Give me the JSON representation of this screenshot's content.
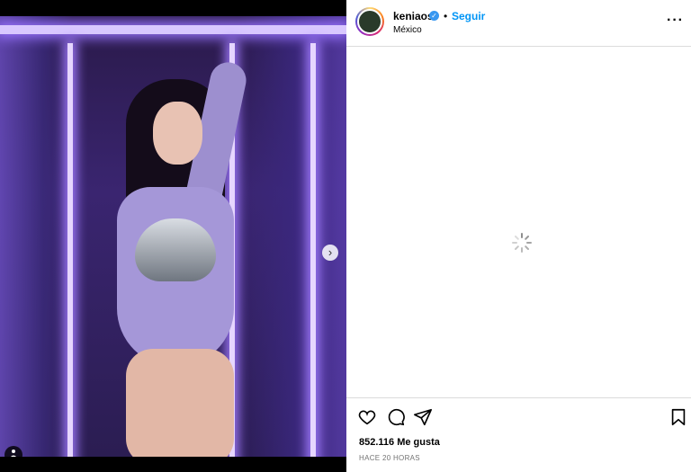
{
  "post": {
    "username": "keniaos",
    "separator": "•",
    "follow_label": "Seguir",
    "location": "México",
    "more_label": "···",
    "likes": "852.116 Me gusta",
    "time": "HACE 20 HORAS",
    "carousel": {
      "count": 3,
      "active": 1
    }
  },
  "icons": {
    "verified": "verified-badge-icon",
    "like": "heart-icon",
    "comment": "comment-icon",
    "share": "paper-plane-icon",
    "save": "bookmark-icon",
    "next": "chevron-right-icon",
    "tag": "user-tag-icon",
    "loading": "spinner-icon"
  },
  "colors": {
    "accent": "#0095f6",
    "verified": "#3897f0",
    "media_bg": "#3a2570"
  }
}
